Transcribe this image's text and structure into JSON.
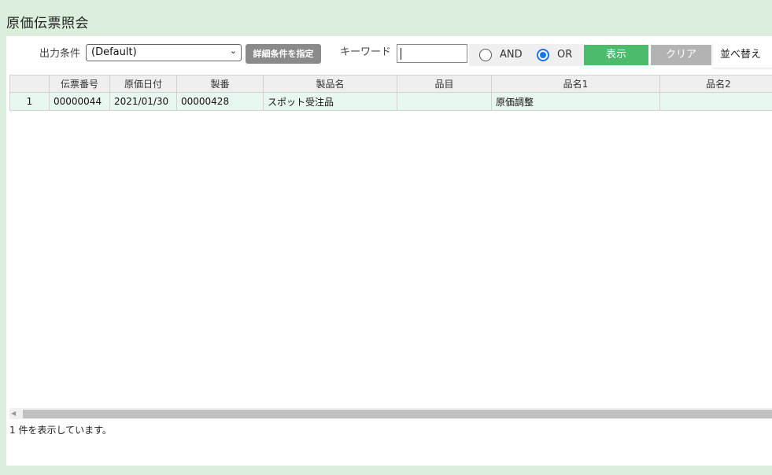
{
  "page": {
    "title": "原価伝票照会"
  },
  "toolbar": {
    "output_condition_label": "出力条件",
    "output_condition_value": "(Default)",
    "detail_button": "詳細条件を指定",
    "keyword_label": "キーワード",
    "keyword_value": "",
    "radio_and": {
      "label": "AND",
      "checked": false
    },
    "radio_or": {
      "label": "OR",
      "checked": true
    },
    "show_button": "表示",
    "clear_button": "クリア",
    "sort_button": "並べ替え"
  },
  "table": {
    "columns": [
      "",
      "伝票番号",
      "原価日付",
      "製番",
      "製品名",
      "品目",
      "品名1",
      "品名2"
    ],
    "rows": [
      [
        "1",
        "00000044",
        "2021/01/30",
        "00000428",
        "スポット受注品",
        "",
        "原価調整",
        ""
      ]
    ]
  },
  "status": {
    "text": "1 件を表示しています。"
  },
  "colors": {
    "background": "#dcefdc",
    "show_button": "#4cbc6c",
    "clear_button": "#b3b3b3",
    "detail_button": "#8a8a8a",
    "row_highlight": "#e9f8ef",
    "radio_selected": "#1a73e8"
  }
}
